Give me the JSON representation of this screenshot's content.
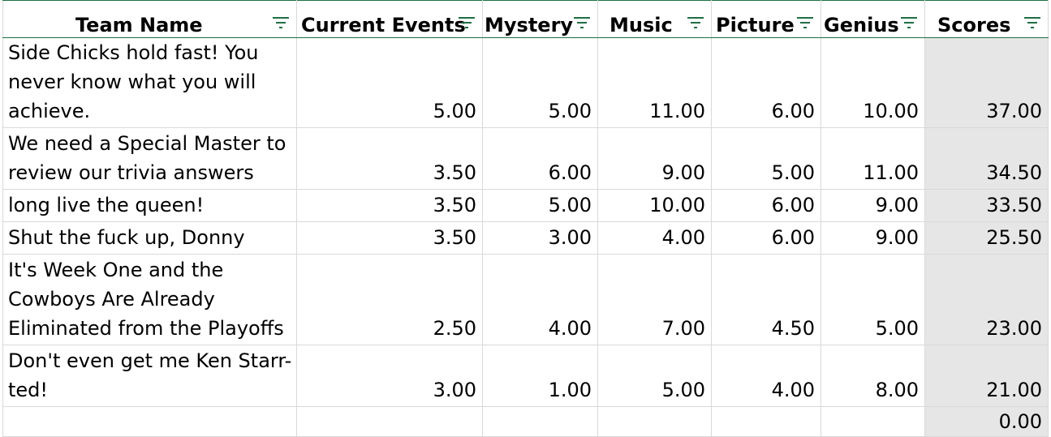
{
  "columns": [
    {
      "label": "Team Name"
    },
    {
      "label": "Current Events"
    },
    {
      "label": "Mystery"
    },
    {
      "label": "Music"
    },
    {
      "label": "Picture"
    },
    {
      "label": "Genius"
    },
    {
      "label": "Scores"
    }
  ],
  "rows": [
    {
      "team": "Side Chicks hold fast! You never know what you will achieve.",
      "current_events": "5.00",
      "mystery": "5.00",
      "music": "11.00",
      "picture": "6.00",
      "genius": "10.00",
      "score": "37.00"
    },
    {
      "team": "We need a Special Master to review our trivia answers",
      "current_events": "3.50",
      "mystery": "6.00",
      "music": "9.00",
      "picture": "5.00",
      "genius": "11.00",
      "score": "34.50"
    },
    {
      "team": "long live the queen!",
      "current_events": "3.50",
      "mystery": "5.00",
      "music": "10.00",
      "picture": "6.00",
      "genius": "9.00",
      "score": "33.50"
    },
    {
      "team": "Shut the fuck up, Donny",
      "current_events": "3.50",
      "mystery": "3.00",
      "music": "4.00",
      "picture": "6.00",
      "genius": "9.00",
      "score": "25.50"
    },
    {
      "team": "It's Week One and the Cowboys Are Already Eliminated from the Playoffs",
      "current_events": "2.50",
      "mystery": "4.00",
      "music": "7.00",
      "picture": "4.50",
      "genius": "5.00",
      "score": "23.00"
    },
    {
      "team": "Don't even get me Ken Starr-ted!",
      "current_events": "3.00",
      "mystery": "1.00",
      "music": "5.00",
      "picture": "4.00",
      "genius": "8.00",
      "score": "21.00"
    },
    {
      "team": "",
      "current_events": "",
      "mystery": "",
      "music": "",
      "picture": "",
      "genius": "",
      "score": "0.00"
    }
  ],
  "icons": {
    "filter": "filter-icon"
  },
  "colors": {
    "header_border": "#1f6e43",
    "filter_icon": "#1f6e43",
    "gridline": "#d9d9d9",
    "score_fill": "#e7e6e6"
  }
}
